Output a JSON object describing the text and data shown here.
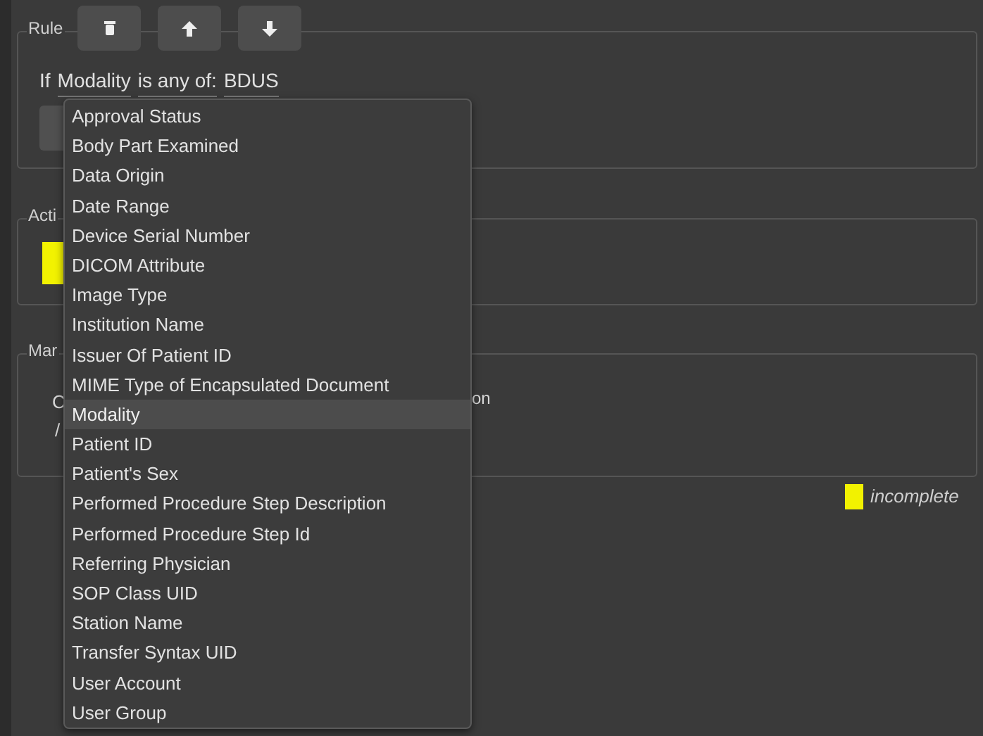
{
  "rule_section": {
    "legend": "Rule",
    "toolbar": [
      {
        "kind": "delete"
      },
      {
        "kind": "up"
      },
      {
        "kind": "down"
      }
    ],
    "condition": {
      "prefix": "If",
      "field": "Modality",
      "operator": "is any of:",
      "value": "BDUS"
    }
  },
  "actions_section": {
    "legend": "Acti"
  },
  "mar_section": {
    "legend": "Mar",
    "line_1": "C",
    "line_1_tail": "on",
    "line_2": "/"
  },
  "status": {
    "label": "incomplete"
  },
  "dropdown": {
    "items": [
      {
        "label": "Approval Status",
        "selected": false
      },
      {
        "label": "Body Part Examined",
        "selected": false
      },
      {
        "label": "Data Origin",
        "selected": false
      },
      {
        "label": "Date Range",
        "selected": false
      },
      {
        "label": "Device Serial Number",
        "selected": false
      },
      {
        "label": "DICOM Attribute",
        "selected": false
      },
      {
        "label": "Image Type",
        "selected": false
      },
      {
        "label": "Institution Name",
        "selected": false
      },
      {
        "label": "Issuer Of Patient ID",
        "selected": false
      },
      {
        "label": "MIME Type of Encapsulated Document",
        "selected": false
      },
      {
        "label": "Modality",
        "selected": true
      },
      {
        "label": "Patient ID",
        "selected": false
      },
      {
        "label": "Patient's Sex",
        "selected": false
      },
      {
        "label": "Performed Procedure Step Description",
        "selected": false
      },
      {
        "label": "Performed Procedure Step Id",
        "selected": false
      },
      {
        "label": "Referring Physician",
        "selected": false
      },
      {
        "label": "SOP Class UID",
        "selected": false
      },
      {
        "label": "Station Name",
        "selected": false
      },
      {
        "label": "Transfer Syntax UID",
        "selected": false
      },
      {
        "label": "User Account",
        "selected": false
      },
      {
        "label": "User Group",
        "selected": false
      }
    ]
  }
}
